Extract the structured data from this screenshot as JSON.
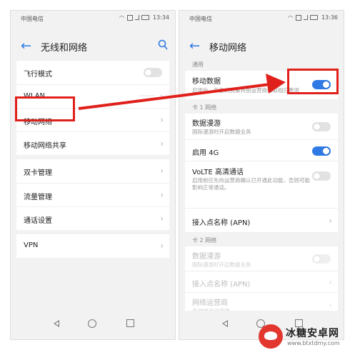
{
  "colors": {
    "accent": "#2f7ae5",
    "highlight": "#e0201b",
    "background": "#f2f2f2"
  },
  "left": {
    "status": {
      "carrier": "中国电信",
      "time": "13:34"
    },
    "title": "无线和网络",
    "icons": {
      "back": "back-arrow-icon",
      "search": "search-icon"
    },
    "groups": [
      [
        {
          "label": "飞行模式",
          "control": "toggle-off"
        },
        {
          "label": "WLAN",
          "value": "·········",
          "control": "chevron"
        },
        {
          "label": "移动网络",
          "control": "chevron",
          "highlighted": true
        },
        {
          "label": "移动网络共享",
          "control": "chevron"
        }
      ],
      [
        {
          "label": "双卡管理",
          "control": "chevron"
        },
        {
          "label": "流量管理",
          "control": "chevron"
        },
        {
          "label": "通话设置",
          "control": "chevron"
        }
      ],
      [
        {
          "label": "VPN",
          "control": "chevron"
        }
      ]
    ]
  },
  "right": {
    "status": {
      "carrier": "中国电信",
      "time": "13:36"
    },
    "title": "移动网络",
    "sections": {
      "general": "通用",
      "card1": "卡 1 网络",
      "card2": "卡 2 网络"
    },
    "general_rows": [
      {
        "label": "移动数据",
        "sub": "启用后，产生的流量将由运营商收取相应费用",
        "control": "toggle-on",
        "highlighted": true
      }
    ],
    "card1_rows": [
      {
        "label": "数据漫游",
        "sub": "国际漫游时开启数据业务",
        "control": "toggle-off"
      },
      {
        "label": "启用 4G",
        "control": "toggle-on"
      },
      {
        "label": "VoLTE 高清通话",
        "sub": "启用前应先向运营商确认已开通此功能，否则可能影响正常通话。",
        "control": "toggle-off"
      },
      {
        "label": "接入点名称 (APN)",
        "control": "chevron"
      }
    ],
    "card2_rows": [
      {
        "label": "数据漫游",
        "sub": "国际漫游时开启数据业务",
        "control": "toggle-disabled"
      },
      {
        "label": "接入点名称 (APN)",
        "control": "chevron"
      },
      {
        "label": "网络运营商",
        "sub": "手动或自动选择",
        "control": "chevron"
      }
    ]
  },
  "nav_icons": [
    "nav-back-icon",
    "nav-home-icon",
    "nav-recent-icon"
  ],
  "annotation_arrow": "red-arrow-icon",
  "watermark": {
    "name": "冰糖安卓网",
    "url": "www.btxtdmy.com"
  }
}
